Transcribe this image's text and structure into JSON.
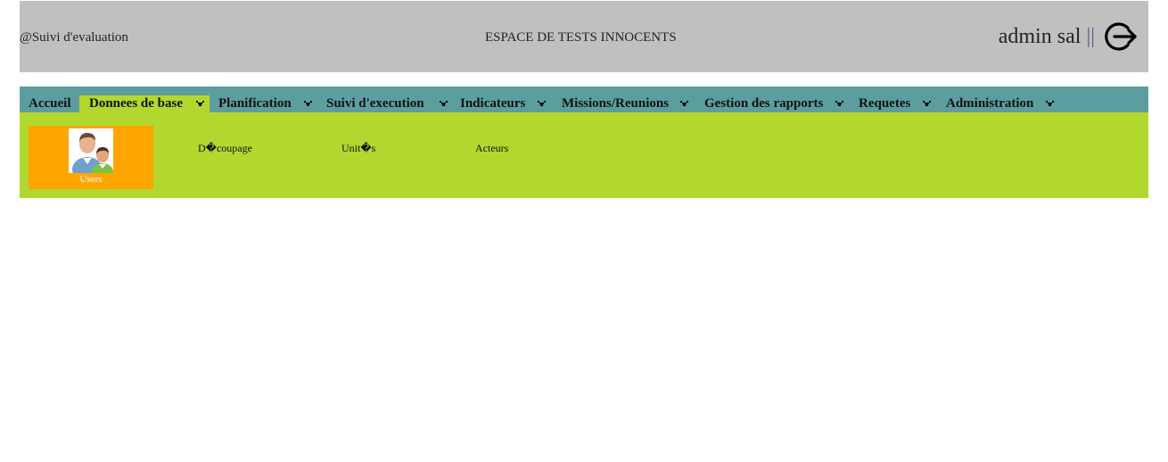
{
  "header": {
    "brand": "@Suivi d'evaluation",
    "space_title": "ESPACE DE TESTS INNOCENTS",
    "user_name": "admin sal",
    "separator": "||",
    "logout_icon": "logout-arrow-circle-icon",
    "background_color": "#c0c0c0"
  },
  "nav": {
    "background_color": "#5c9ea0",
    "active_color": "#b2d830",
    "items": [
      {
        "label": "Accueil",
        "has_dropdown": false,
        "active": false
      },
      {
        "label": "Donnees de base",
        "has_dropdown": true,
        "active": true
      },
      {
        "label": "Planification",
        "has_dropdown": true,
        "active": false
      },
      {
        "label": "Suivi d'execution",
        "has_dropdown": true,
        "active": false
      },
      {
        "label": "Indicateurs",
        "has_dropdown": true,
        "active": false
      },
      {
        "label": "Missions/Reunions",
        "has_dropdown": true,
        "active": false
      },
      {
        "label": "Gestion des rapports",
        "has_dropdown": true,
        "active": false
      },
      {
        "label": "Requetes",
        "has_dropdown": true,
        "active": false
      },
      {
        "label": "Administration",
        "has_dropdown": true,
        "active": false
      }
    ],
    "dropdown_icon": "chevron-down-icon"
  },
  "submenu": {
    "background_color": "#b2d830",
    "tile": {
      "label": "Users",
      "icon": "users-icon",
      "color": "#ffa500"
    },
    "links": [
      {
        "label": "D�coupage"
      },
      {
        "label": "Unit�s"
      },
      {
        "label": "Acteurs"
      }
    ]
  }
}
